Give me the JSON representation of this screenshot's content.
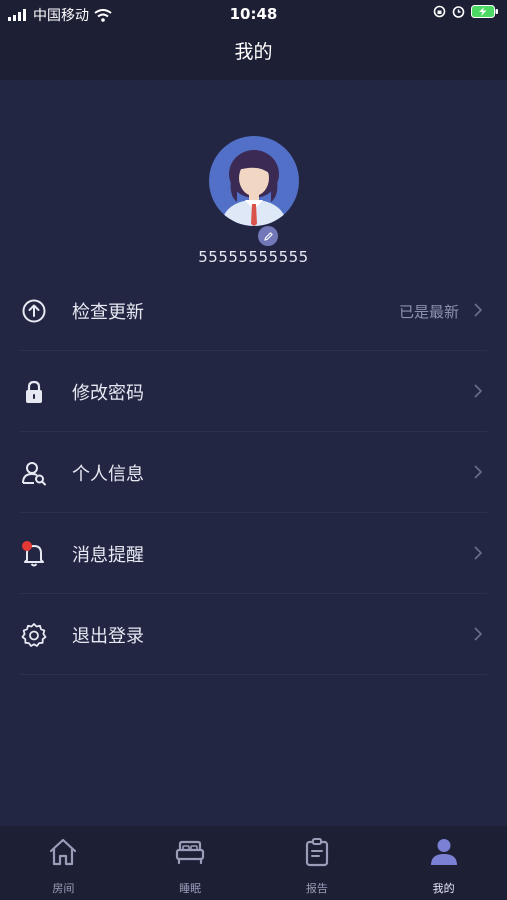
{
  "status_bar": {
    "carrier": "中国移动",
    "time": "10:48"
  },
  "header": {
    "title": "我的"
  },
  "profile": {
    "username": "55555555555"
  },
  "menu": {
    "items": [
      {
        "label": "检查更新",
        "status": "已是最新",
        "icon": "upload-circle-icon"
      },
      {
        "label": "修改密码",
        "icon": "lock-icon"
      },
      {
        "label": "个人信息",
        "icon": "user-search-icon"
      },
      {
        "label": "消息提醒",
        "icon": "bell-icon"
      },
      {
        "label": "退出登录",
        "icon": "gear-icon"
      }
    ]
  },
  "tab_bar": {
    "tabs": [
      {
        "label": "房间",
        "icon": "home-icon"
      },
      {
        "label": "睡眠",
        "icon": "bed-icon"
      },
      {
        "label": "报告",
        "icon": "clipboard-icon"
      },
      {
        "label": "我的",
        "icon": "person-icon"
      }
    ],
    "active_index": 3
  },
  "colors": {
    "background": "#232643",
    "bar_background": "#1d1f35",
    "accent": "#7c80d4",
    "notification_dot": "#e53935"
  }
}
